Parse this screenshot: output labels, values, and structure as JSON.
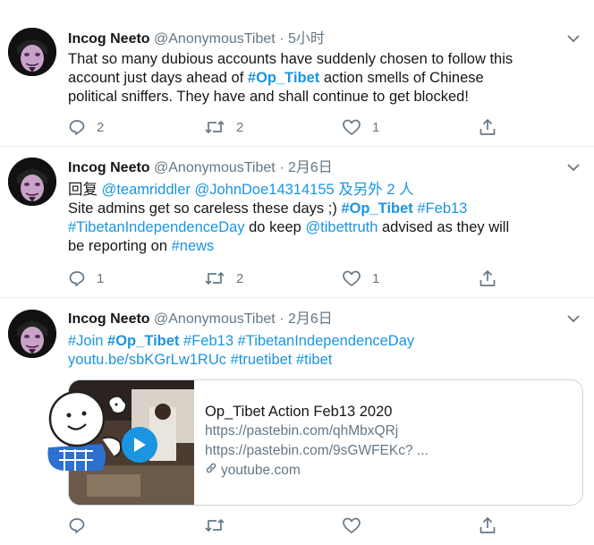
{
  "tweets": [
    {
      "name": "Incog Neeto",
      "handle": "@AnonymousTibet",
      "dot": "·",
      "time": "5小时",
      "lines": [
        [
          {
            "t": "That so many dubious accounts have suddenly chosen to follow this",
            "c": ""
          }
        ],
        [
          {
            "t": "account just days ahead of ",
            "c": ""
          },
          {
            "t": "#Op_Tibet",
            "c": "lnkb"
          },
          {
            "t": " action smells of Chinese",
            "c": ""
          }
        ],
        [
          {
            "t": "political sniffers. They have and shall continue to get blocked!",
            "c": ""
          }
        ]
      ],
      "counts": {
        "reply": "2",
        "retweet": "2",
        "like": "1"
      }
    },
    {
      "name": "Incog Neeto",
      "handle": "@AnonymousTibet",
      "dot": "·",
      "time": "2月6日",
      "lines": [
        [
          {
            "t": "回复 ",
            "c": ""
          },
          {
            "t": "@teamriddler",
            "c": "lnk"
          },
          {
            "t": " ",
            "c": ""
          },
          {
            "t": "@JohnDoe14314155",
            "c": "lnk"
          },
          {
            "t": " 及另外 2 人",
            "c": "lnk"
          }
        ],
        [
          {
            "t": "Site admins get so careless these days ;) ",
            "c": ""
          },
          {
            "t": "#Op_Tibet",
            "c": "lnkb"
          },
          {
            "t": " ",
            "c": ""
          },
          {
            "t": "#Feb13",
            "c": "lnk"
          }
        ],
        [
          {
            "t": " ",
            "c": ""
          },
          {
            "t": "#TibetanIndependenceDay",
            "c": "lnk"
          },
          {
            "t": " do keep ",
            "c": ""
          },
          {
            "t": "@tibettruth",
            "c": "lnk"
          },
          {
            "t": " advised as they will",
            "c": ""
          }
        ],
        [
          {
            "t": "be reporting on ",
            "c": ""
          },
          {
            "t": "#news",
            "c": "lnk"
          }
        ]
      ],
      "counts": {
        "reply": "1",
        "retweet": "2",
        "like": "1"
      }
    },
    {
      "name": "Incog Neeto",
      "handle": "@AnonymousTibet",
      "dot": "·",
      "time": "2月6日",
      "lines": [
        [
          {
            "t": "#Join",
            "c": "lnk"
          },
          {
            "t": " ",
            "c": ""
          },
          {
            "t": "#Op_Tibet",
            "c": "lnkb"
          },
          {
            "t": " ",
            "c": ""
          },
          {
            "t": "#Feb13",
            "c": "lnk"
          },
          {
            "t": " ",
            "c": ""
          },
          {
            "t": "#TibetanIndependenceDay",
            "c": "lnk"
          }
        ],
        [
          {
            "t": " ",
            "c": ""
          },
          {
            "t": "youtu.be/sbKGrLw1RUc",
            "c": "lnk"
          },
          {
            "t": " ",
            "c": ""
          },
          {
            "t": "#truetibet",
            "c": "lnk"
          },
          {
            "t": " ",
            "c": ""
          },
          {
            "t": "#tibet",
            "c": "lnk"
          }
        ]
      ],
      "counts": {
        "reply": "",
        "retweet": "",
        "like": ""
      }
    }
  ],
  "card": {
    "title": "Op_Tibet Action Feb13 2020",
    "desc1": "https://pastebin.com/qhMbxQRj",
    "desc2": "https://pastebin.com/9sGWFEKc? ...",
    "domain": "youtube.com"
  },
  "icons": {
    "reply": "reply-icon",
    "retweet": "retweet-icon",
    "like": "like-icon",
    "share": "share-icon",
    "more": "chevron-down-icon",
    "link": "link-icon",
    "play": "play-icon"
  },
  "colors": {
    "link": "#1b95e0",
    "muted": "#657786",
    "text": "#14171a",
    "divider": "#e6ecf0"
  }
}
